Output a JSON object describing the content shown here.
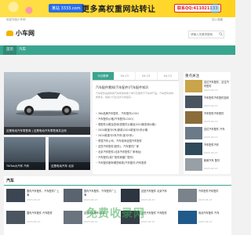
{
  "ad": {
    "badge": "某站 3333.com",
    "headline": "更多高权重网站转让",
    "phone": "联系QQ:411021133"
  },
  "topstrip": {
    "left": "欢迎光临小车网",
    "right": "加入收藏"
  },
  "header": {
    "logo_text": "小车网",
    "search_placeholder": "请输入关键词搜索"
  },
  "nav": {
    "items": [
      "首页",
      "汽车"
    ]
  },
  "main_slide": {
    "caption": "这是电动汽车零售商 | 这是电动汽车零售商并且你"
  },
  "thumbs": [
    {
      "caption": "TikTok大汽车 汽车"
    },
    {
      "caption": "这是电动汽车 北京"
    }
  ],
  "tabs": [
    "今日推荐",
    "04-13",
    "04-13",
    "04-13"
  ],
  "news": {
    "headline": "汽车配件需知(汽车配件)汽车配件知识",
    "desc": "汽车配件是指构成汽车整体的各个单元及服务于汽车的产品。汽车配件的种类繁多，随着人们生活水平的提高...",
    "items": [
      "360品牌汽车配件，汽车配件LOGO",
      "汽车配件价格(汽车配件LOGO)",
      "零配件价格及查询(零配件价格及2024款查询价格)",
      "2024款宝马5系(新款)2024款宝马5系价格",
      "2024款宝马5系汽车(宝马5系)",
      "李斌汽车公司，汽车电商全国汽车配件",
      "这些汽车配件(配件)，汽车配件厂家",
      "北京汽车配件(北京汽车配件厂家地址)",
      "汽车配件(原厂配件和副厂配件)",
      "汽车配件都有哪些种类(汽车配件)汽车配件"
    ]
  },
  "sidebar": {
    "title": "重点关注",
    "items": [
      {
        "title": "这位汽车配件，这位汽车配件",
        "date": "2023-04-13"
      },
      {
        "title": "汽车配件汽车配件如何",
        "date": "2023-04-13"
      },
      {
        "title": "汽车配件汽车配件",
        "date": "2023-04-13"
      },
      {
        "title": "这位汽车配件 汽车",
        "date": "2023-04-13"
      },
      {
        "title": "汽车配件汽车",
        "date": "2023-04-13"
      },
      {
        "title": "新款汽车 配件",
        "date": "2023-04-13"
      }
    ]
  },
  "section": {
    "title": "汽车",
    "cards": [
      {
        "title": "国内汽车配件，汽车配件厂上海",
        "date": "2023-04-13"
      },
      {
        "title": "国内汽车配件，汽车配件厂上海",
        "date": "2023-04-13"
      },
      {
        "title": "这是汽车配件 北京汽车",
        "date": "2023-04-13"
      },
      {
        "title": "汽车配件汽车配件",
        "date": "2023-04-13"
      },
      {
        "title": "国内汽车配件 汽车配件",
        "date": "2023-04-13"
      },
      {
        "title": "这是汽车配件 北京",
        "date": "2023-04-13"
      },
      {
        "title": "这些汽车配件 汽车配件",
        "date": "2023-04-13"
      },
      {
        "title": "电动汽车配件 汽车",
        "date": "2023-04-13"
      }
    ]
  },
  "watermark": "免费收录网",
  "colors": {
    "accent": "#3aa58f",
    "ad_bg": "#ffd21e"
  }
}
